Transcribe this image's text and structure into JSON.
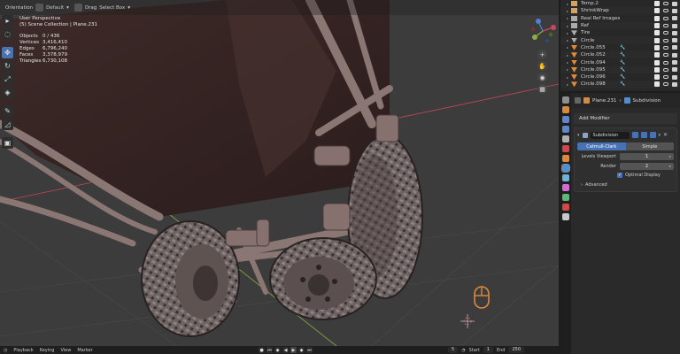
{
  "viewport_header": {
    "orientation_label": "Orientation",
    "orientation_value": "Default",
    "drag_label": "Drag",
    "select_value": "Select Box"
  },
  "toolbar_icons": [
    "cursor-icon",
    "select-box-icon",
    "move-icon",
    "rotate-icon",
    "scale-icon",
    "transform-icon",
    "annotate-icon",
    "measure-icon",
    "add-cube-icon"
  ],
  "stats": {
    "view_name": "User Perspective",
    "collection": "(5) Scene Collection | Plane.231",
    "rows": [
      {
        "key": "Objects",
        "value": "0 / 436"
      },
      {
        "key": "Vertices",
        "value": "3,416,410"
      },
      {
        "key": "Edges",
        "value": "6,796,240"
      },
      {
        "key": "Faces",
        "value": "3,378,979"
      },
      {
        "key": "Triangles",
        "value": "6,730,108"
      }
    ]
  },
  "gizmo": {
    "x": "X",
    "y": "Y",
    "z": "Z"
  },
  "outliner": {
    "rows": [
      {
        "name": "Temp.2",
        "icon": "empty-icon",
        "mod": false,
        "icon_color": "#d9a060"
      },
      {
        "name": "ShrinkWrap",
        "icon": "empty-icon",
        "mod": false,
        "icon_color": "#d9a060"
      },
      {
        "name": "Real Ref Images",
        "icon": "image-icon",
        "mod": false,
        "icon_color": "#aaaaaa"
      },
      {
        "name": "Ref",
        "icon": "image-icon",
        "mod": false,
        "icon_color": "#aaaaaa"
      },
      {
        "name": "Tire",
        "icon": "mesh-icon",
        "mod": false,
        "icon_color": "#aaaaaa"
      },
      {
        "name": "Circle",
        "icon": "mesh-icon",
        "mod": false,
        "icon_color": "#aaaaaa"
      },
      {
        "name": "Circle.055",
        "icon": "mesh-icon",
        "mod": true,
        "icon_color": "#e08a3a"
      },
      {
        "name": "Circle.052",
        "icon": "mesh-icon",
        "mod": true,
        "icon_color": "#e08a3a"
      },
      {
        "name": "Circle.094",
        "icon": "mesh-icon",
        "mod": true,
        "icon_color": "#e08a3a"
      },
      {
        "name": "Circle.095",
        "icon": "mesh-icon",
        "mod": true,
        "icon_color": "#e08a3a"
      },
      {
        "name": "Circle.096",
        "icon": "mesh-icon",
        "mod": true,
        "icon_color": "#e08a3a"
      },
      {
        "name": "Circle.098",
        "icon": "mesh-icon",
        "mod": true,
        "icon_color": "#e08a3a"
      }
    ]
  },
  "properties": {
    "breadcrumb_object": "Plane.231",
    "breadcrumb_sep": "›",
    "breadcrumb_modifier": "Subdivision",
    "add_modifier_label": "Add Modifier",
    "modifier": {
      "name": "Subdivision",
      "mode_catmull": "Catmull-Clark",
      "mode_simple": "Simple",
      "levels_viewport_label": "Levels Viewport",
      "levels_viewport_value": "1",
      "render_label": "Render",
      "render_value": "2",
      "optimal_display_label": "Optimal Display",
      "optimal_display_checked": true,
      "advanced_label": "Advanced"
    },
    "tab_colors": [
      "#8f8f8f",
      "#d68a3c",
      "#5e86c9",
      "#5e86c9",
      "#b0b0b0",
      "#d04848",
      "#e0883a",
      "#4d90d6",
      "#6fb0d6",
      "#d46bd4",
      "#5cb878",
      "#d04848",
      "#c8c8c8"
    ]
  },
  "timeline": {
    "playback_label": "Playback",
    "keying_label": "Keying",
    "view_label": "View",
    "marker_label": "Marker",
    "current_frame": "5",
    "start_label": "Start",
    "start_value": "1",
    "end_label": "End",
    "end_value": "250"
  },
  "colors": {
    "accent": "#4772b3",
    "viewport_bg": "#3c3c3c",
    "panel_bg": "#2a2a2a",
    "x_axis": "#c8485a",
    "y_axis": "#8ab040",
    "z_axis": "#4f7fd6"
  }
}
